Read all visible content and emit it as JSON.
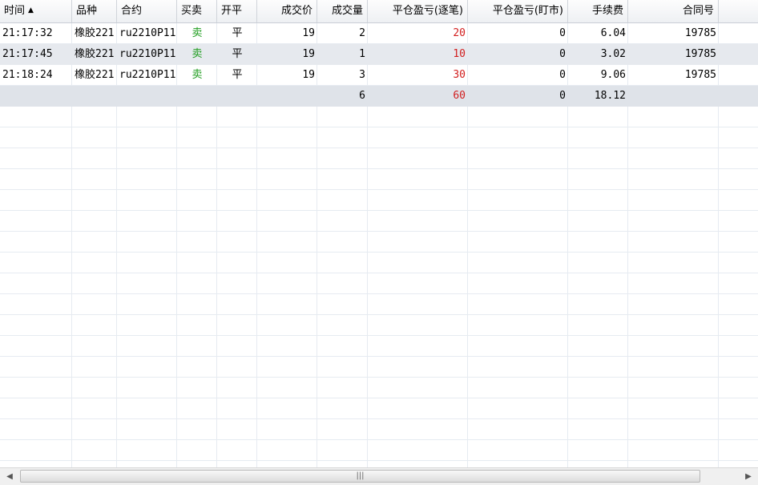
{
  "columns": [
    {
      "label": "时间",
      "sort_icon": "▲"
    },
    {
      "label": "品种"
    },
    {
      "label": "合约"
    },
    {
      "label": "买卖"
    },
    {
      "label": "开平"
    },
    {
      "label": "成交价"
    },
    {
      "label": "成交量"
    },
    {
      "label": "平仓盈亏(逐笔)"
    },
    {
      "label": "平仓盈亏(盯市)"
    },
    {
      "label": "手续费"
    },
    {
      "label": "合同号"
    }
  ],
  "rows": [
    {
      "time": "21:17:32",
      "product": "橡胶221",
      "contract": "ru2210P11",
      "side": "卖",
      "open_close": "平",
      "price": "19",
      "volume": "2",
      "pnl_trade": "20",
      "pnl_mark": "0",
      "fee": "6.04",
      "contract_no": "19785"
    },
    {
      "time": "21:17:45",
      "product": "橡胶221",
      "contract": "ru2210P11",
      "side": "卖",
      "open_close": "平",
      "price": "19",
      "volume": "1",
      "pnl_trade": "10",
      "pnl_mark": "0",
      "fee": "3.02",
      "contract_no": "19785"
    },
    {
      "time": "21:18:24",
      "product": "橡胶221",
      "contract": "ru2210P11",
      "side": "卖",
      "open_close": "平",
      "price": "19",
      "volume": "3",
      "pnl_trade": "30",
      "pnl_mark": "0",
      "fee": "9.06",
      "contract_no": "19785"
    }
  ],
  "summary": {
    "volume": "6",
    "pnl_trade": "60",
    "pnl_mark": "0",
    "fee": "18.12"
  },
  "scrollbar": {
    "left_icon": "◀",
    "right_icon": "▶",
    "grip": "|||"
  },
  "colors": {
    "sell": "#1f9d1f",
    "profit": "#d21f1f",
    "selected_row": "#e6e9ee",
    "summary_row": "#dfe3e9"
  }
}
